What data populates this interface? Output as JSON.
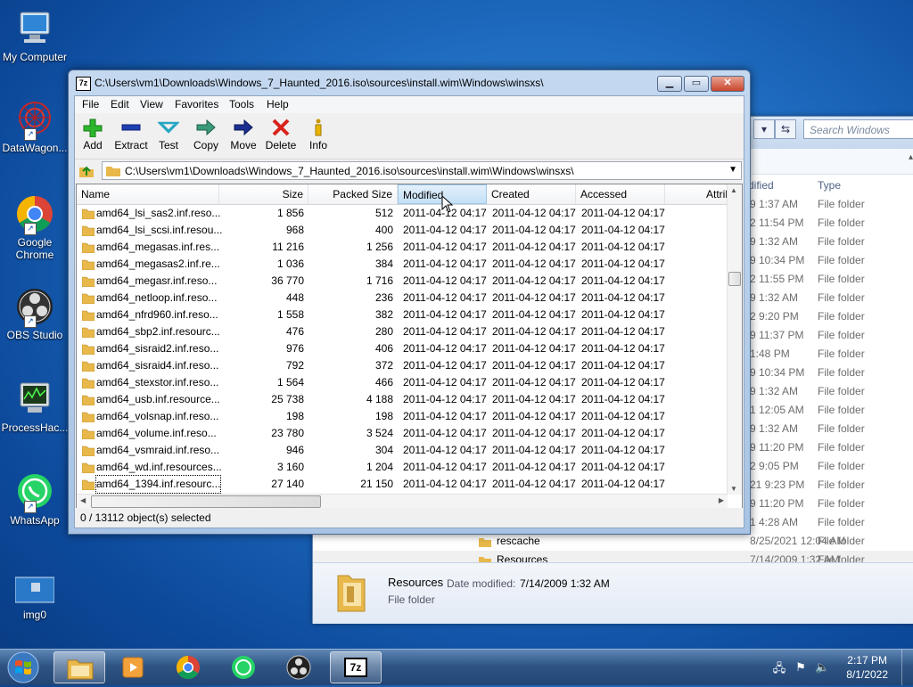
{
  "desktop": {
    "icons": [
      {
        "label": "My Computer"
      },
      {
        "label": "DataWagon..."
      },
      {
        "label": "Google Chrome"
      },
      {
        "label": "OBS Studio"
      },
      {
        "label": "ProcessHac..."
      },
      {
        "label": "WhatsApp"
      },
      {
        "label": "img0"
      }
    ]
  },
  "explorer": {
    "search_placeholder": "Search Windows",
    "col_modified": "dified",
    "col_type": "Type",
    "rows": [
      {
        "time": "9 1:37 AM",
        "type": "File folder"
      },
      {
        "time": "2 11:54 PM",
        "type": "File folder"
      },
      {
        "time": "9 1:32 AM",
        "type": "File folder"
      },
      {
        "time": "9 10:34 PM",
        "type": "File folder"
      },
      {
        "time": "2 11:55 PM",
        "type": "File folder"
      },
      {
        "time": "9 1:32 AM",
        "type": "File folder"
      },
      {
        "time": "2 9:20 PM",
        "type": "File folder"
      },
      {
        "time": "9 11:37 PM",
        "type": "File folder"
      },
      {
        "time": "1:48 PM",
        "type": "File folder"
      },
      {
        "time": "9 10:34 PM",
        "type": "File folder"
      },
      {
        "time": "9 1:32 AM",
        "type": "File folder"
      },
      {
        "time": "1 12:05 AM",
        "type": "File folder"
      },
      {
        "time": "9 1:32 AM",
        "type": "File folder"
      },
      {
        "time": "9 11:20 PM",
        "type": "File folder"
      },
      {
        "time": "2 9:05 PM",
        "type": "File folder"
      },
      {
        "time": "21 9:23 PM",
        "type": "File folder"
      },
      {
        "time": "9 11:20 PM",
        "type": "File folder"
      },
      {
        "time": "1 4:28 AM",
        "type": "File folder"
      },
      {
        "name": "rescache",
        "time": "8/25/2021 12:04 AM",
        "type": "File folder"
      },
      {
        "name": "Resources",
        "time": "7/14/2009 1:32 AM",
        "type": "File folder"
      }
    ],
    "details": {
      "name": "Resources",
      "date_label": "Date modified:",
      "date_value": "7/14/2009 1:32 AM",
      "type": "File folder"
    }
  },
  "zip": {
    "title": "C:\\Users\\vm1\\Downloads\\Windows_7_Haunted_2016.iso\\sources\\install.wim\\Windows\\winsxs\\",
    "title_icon": "7z",
    "menu": [
      "File",
      "Edit",
      "View",
      "Favorites",
      "Tools",
      "Help"
    ],
    "toolbar": [
      "Add",
      "Extract",
      "Test",
      "Copy",
      "Move",
      "Delete",
      "Info"
    ],
    "address": "C:\\Users\\vm1\\Downloads\\Windows_7_Haunted_2016.iso\\sources\\install.wim\\Windows\\winsxs\\",
    "columns": [
      "Name",
      "Size",
      "Packed Size",
      "Modified",
      "Created",
      "Accessed",
      "Attrib"
    ],
    "rows": [
      {
        "name": "amd64_lsi_sas2.inf.reso...",
        "size": "1 856",
        "packed": "512",
        "modified": "2011-04-12 04:17",
        "created": "2011-04-12 04:17",
        "accessed": "2011-04-12 04:17"
      },
      {
        "name": "amd64_lsi_scsi.inf.resou...",
        "size": "968",
        "packed": "400",
        "modified": "2011-04-12 04:17",
        "created": "2011-04-12 04:17",
        "accessed": "2011-04-12 04:17"
      },
      {
        "name": "amd64_megasas.inf.res...",
        "size": "11 216",
        "packed": "1 256",
        "modified": "2011-04-12 04:17",
        "created": "2011-04-12 04:17",
        "accessed": "2011-04-12 04:17"
      },
      {
        "name": "amd64_megasas2.inf.re...",
        "size": "1 036",
        "packed": "384",
        "modified": "2011-04-12 04:17",
        "created": "2011-04-12 04:17",
        "accessed": "2011-04-12 04:17"
      },
      {
        "name": "amd64_megasr.inf.reso...",
        "size": "36 770",
        "packed": "1 716",
        "modified": "2011-04-12 04:17",
        "created": "2011-04-12 04:17",
        "accessed": "2011-04-12 04:17"
      },
      {
        "name": "amd64_netloop.inf.reso...",
        "size": "448",
        "packed": "236",
        "modified": "2011-04-12 04:17",
        "created": "2011-04-12 04:17",
        "accessed": "2011-04-12 04:17"
      },
      {
        "name": "amd64_nfrd960.inf.reso...",
        "size": "1 558",
        "packed": "382",
        "modified": "2011-04-12 04:17",
        "created": "2011-04-12 04:17",
        "accessed": "2011-04-12 04:17"
      },
      {
        "name": "amd64_sbp2.inf.resourc...",
        "size": "476",
        "packed": "280",
        "modified": "2011-04-12 04:17",
        "created": "2011-04-12 04:17",
        "accessed": "2011-04-12 04:17"
      },
      {
        "name": "amd64_sisraid2.inf.reso...",
        "size": "976",
        "packed": "406",
        "modified": "2011-04-12 04:17",
        "created": "2011-04-12 04:17",
        "accessed": "2011-04-12 04:17"
      },
      {
        "name": "amd64_sisraid4.inf.reso...",
        "size": "792",
        "packed": "372",
        "modified": "2011-04-12 04:17",
        "created": "2011-04-12 04:17",
        "accessed": "2011-04-12 04:17"
      },
      {
        "name": "amd64_stexstor.inf.reso...",
        "size": "1 564",
        "packed": "466",
        "modified": "2011-04-12 04:17",
        "created": "2011-04-12 04:17",
        "accessed": "2011-04-12 04:17"
      },
      {
        "name": "amd64_usb.inf.resource...",
        "size": "25 738",
        "packed": "4 188",
        "modified": "2011-04-12 04:17",
        "created": "2011-04-12 04:17",
        "accessed": "2011-04-12 04:17"
      },
      {
        "name": "amd64_volsnap.inf.reso...",
        "size": "198",
        "packed": "198",
        "modified": "2011-04-12 04:17",
        "created": "2011-04-12 04:17",
        "accessed": "2011-04-12 04:17"
      },
      {
        "name": "amd64_volume.inf.reso...",
        "size": "23 780",
        "packed": "3 524",
        "modified": "2011-04-12 04:17",
        "created": "2011-04-12 04:17",
        "accessed": "2011-04-12 04:17"
      },
      {
        "name": "amd64_vsmraid.inf.reso...",
        "size": "946",
        "packed": "304",
        "modified": "2011-04-12 04:17",
        "created": "2011-04-12 04:17",
        "accessed": "2011-04-12 04:17"
      },
      {
        "name": "amd64_wd.inf.resources...",
        "size": "3 160",
        "packed": "1 204",
        "modified": "2011-04-12 04:17",
        "created": "2011-04-12 04:17",
        "accessed": "2011-04-12 04:17"
      },
      {
        "name": "amd64_1394.inf.resourc...",
        "size": "27 140",
        "packed": "21 150",
        "modified": "2011-04-12 04:17",
        "created": "2011-04-12 04:17",
        "accessed": "2011-04-12 04:17"
      }
    ],
    "status": "0 / 13112 object(s) selected"
  },
  "taskbar": {
    "time": "2:17 PM",
    "date": "8/1/2022",
    "active_icon": "7z"
  },
  "colors": {
    "folder": "#e8b84a",
    "add": "#2db52d",
    "extract": "#1e3fb0",
    "test": "#27a6c2",
    "delete": "#d8221b"
  }
}
